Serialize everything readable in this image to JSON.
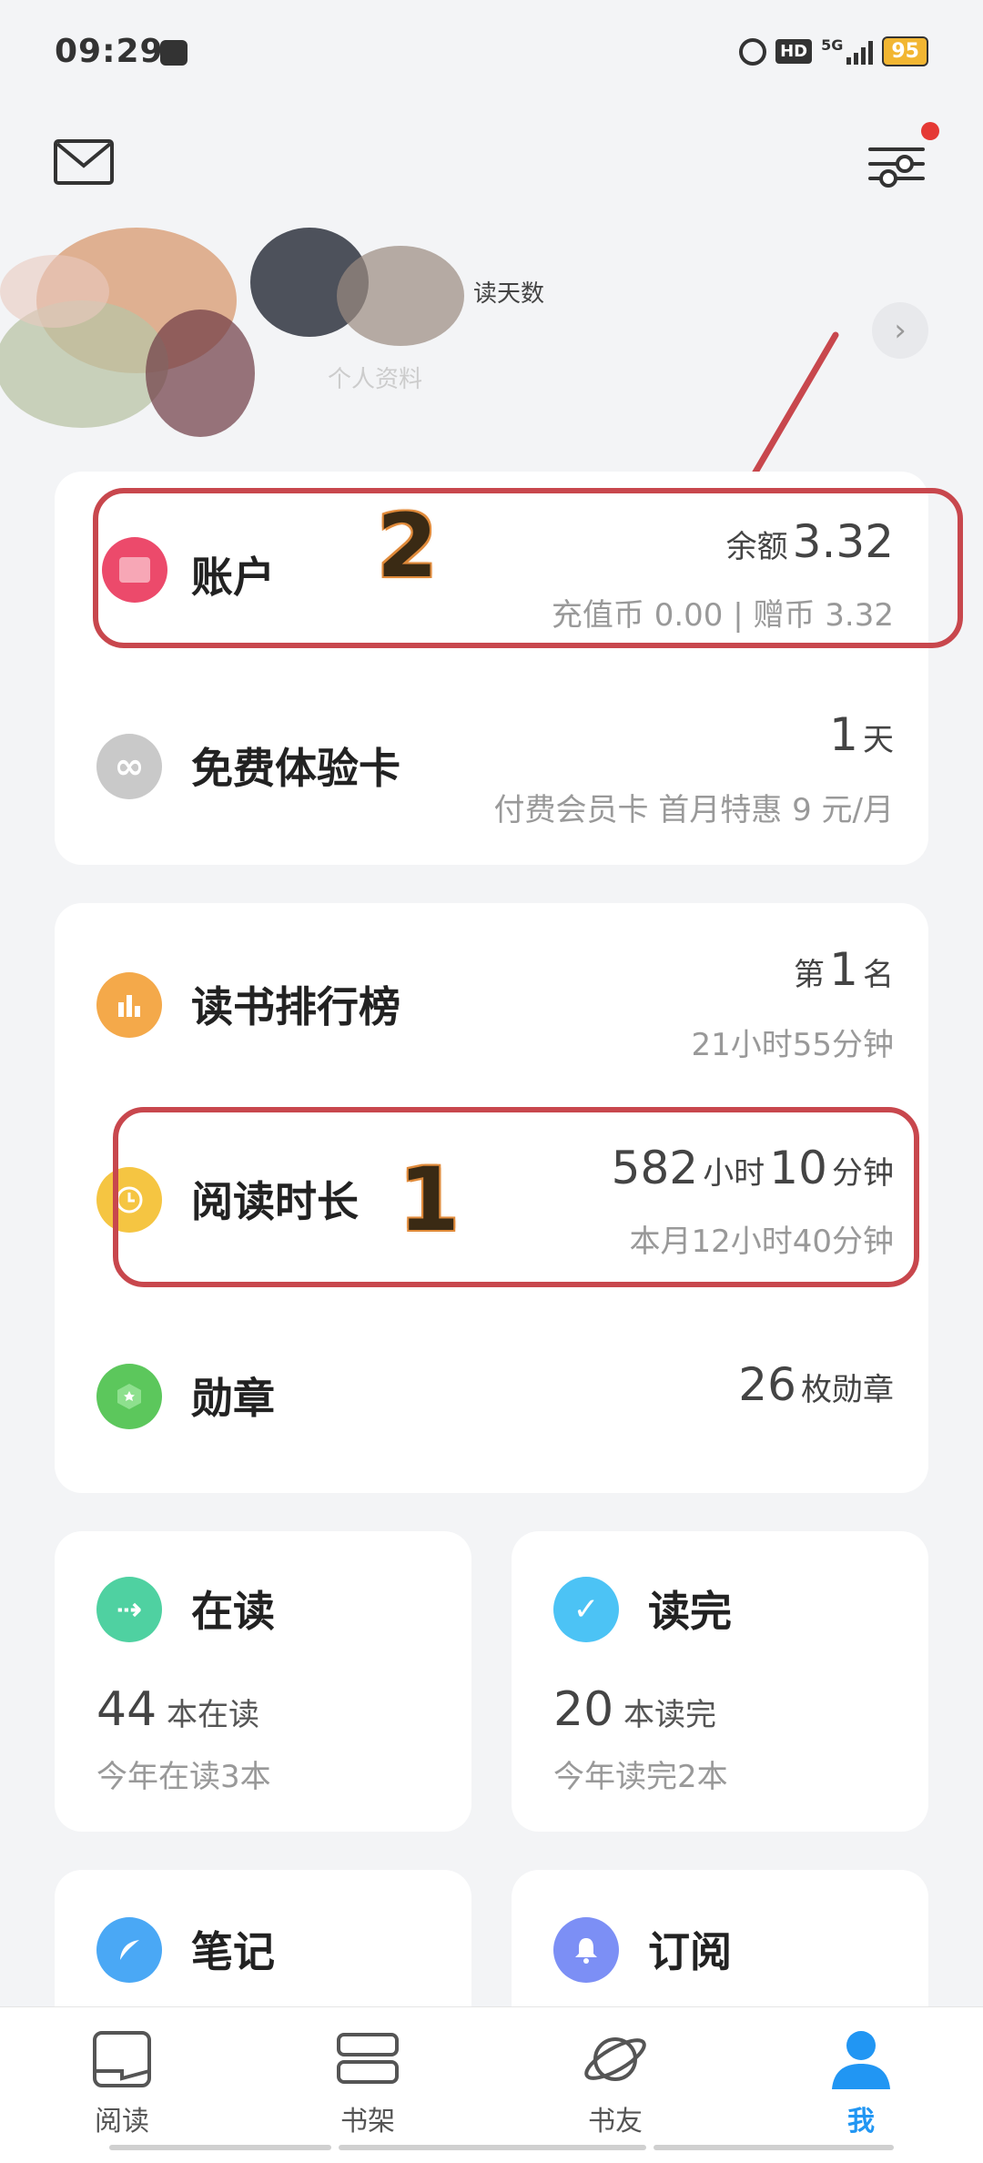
{
  "status_bar": {
    "time": "09:29",
    "signal_label": "5G",
    "hd_label": "HD",
    "battery": "95"
  },
  "header": {
    "mail_icon": "mail-icon",
    "filter_icon": "sliders-icon"
  },
  "profile": {
    "read_days_label": "读天数",
    "personal_info_label": "个人资料"
  },
  "account": {
    "label": "账户",
    "balance_prefix": "余额",
    "balance_value": "3.32",
    "detail": "充值币 0.00 | 赠币 3.32"
  },
  "trial_card": {
    "label": "免费体验卡",
    "days_value": "1",
    "days_unit": "天",
    "detail": "付费会员卡 首月特惠 9 元/月"
  },
  "ranking": {
    "label": "读书排行榜",
    "rank_prefix": "第",
    "rank_value": "1",
    "rank_suffix": "名",
    "detail": "21小时55分钟"
  },
  "reading_time": {
    "label": "阅读时长",
    "hours_value": "582",
    "hours_unit": "小时",
    "minutes_value": "10",
    "minutes_unit": "分钟",
    "detail": "本月12小时40分钟"
  },
  "medals": {
    "label": "勋章",
    "count_value": "26",
    "count_unit": "枚勋章"
  },
  "annotations": {
    "first": "1",
    "second": "2"
  },
  "reading_now": {
    "label": "在读",
    "count_value": "44",
    "count_unit": "本在读",
    "detail": "今年在读3本"
  },
  "finished": {
    "label": "读完",
    "count_value": "20",
    "count_unit": "本读完",
    "detail": "今年读完2本"
  },
  "notes": {
    "label": "笔记"
  },
  "subscriptions": {
    "label": "订阅"
  },
  "bottom_nav": {
    "items": [
      {
        "label": "阅读"
      },
      {
        "label": "书架"
      },
      {
        "label": "书友"
      },
      {
        "label": "我"
      }
    ]
  },
  "colors": {
    "accent_blue": "#2196f3",
    "annotation_red": "#c8474d",
    "account_pink": "#ec4a6b",
    "ranking_orange": "#f4a94a",
    "reading_yellow": "#f5c542",
    "medal_green": "#5cc75c",
    "reading_teal": "#4fd1a1",
    "finished_blue": "#4cc3f5"
  }
}
